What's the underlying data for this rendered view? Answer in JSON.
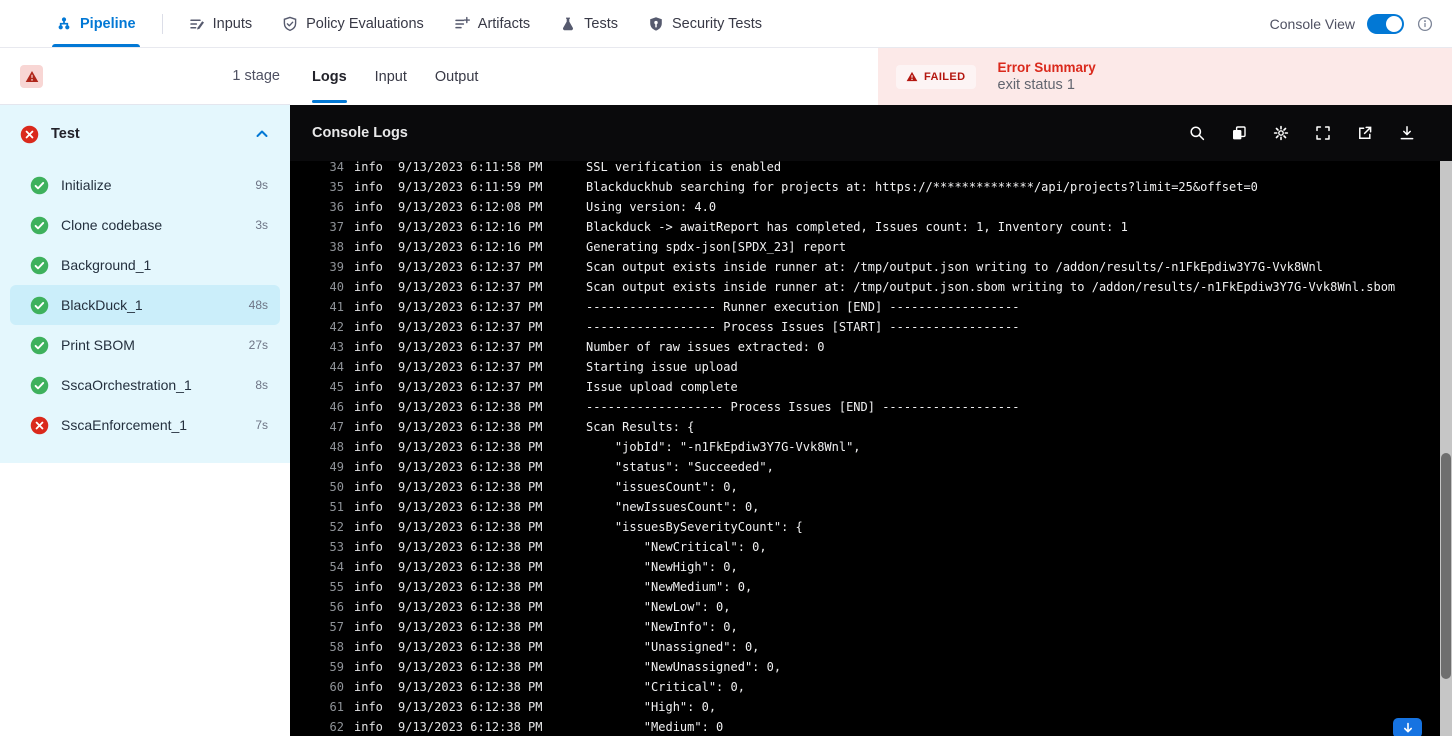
{
  "topnav": {
    "tabs": [
      {
        "label": "Pipeline",
        "icon": "pipeline-icon",
        "active": true
      },
      {
        "label": "Inputs",
        "icon": "inputs-icon",
        "active": false
      },
      {
        "label": "Policy Evaluations",
        "icon": "policy-evaluations-icon",
        "active": false
      },
      {
        "label": "Artifacts",
        "icon": "artifacts-icon",
        "active": false
      },
      {
        "label": "Tests",
        "icon": "tests-icon",
        "active": false
      },
      {
        "label": "Security Tests",
        "icon": "security-tests-icon",
        "active": false
      }
    ],
    "console_view": {
      "label": "Console View",
      "enabled": true,
      "info_icon": "info-circle-icon"
    }
  },
  "sidebar": {
    "stage_count": "1 stage",
    "warning_icon": "warning-triangle-icon",
    "stage": {
      "name": "Test",
      "status": "failed",
      "status_icon": "error-circle-icon",
      "collapse_icon": "chevron-up-icon"
    },
    "steps": [
      {
        "label": "Initialize",
        "duration": "9s",
        "status": "success",
        "selected": false
      },
      {
        "label": "Clone codebase",
        "duration": "3s",
        "status": "success",
        "selected": false
      },
      {
        "label": "Background_1",
        "duration": "",
        "status": "success",
        "selected": false
      },
      {
        "label": "BlackDuck_1",
        "duration": "48s",
        "status": "success",
        "selected": true
      },
      {
        "label": "Print SBOM",
        "duration": "27s",
        "status": "success",
        "selected": false
      },
      {
        "label": "SscaOrchestration_1",
        "duration": "8s",
        "status": "success",
        "selected": false
      },
      {
        "label": "SscaEnforcement_1",
        "duration": "7s",
        "status": "failed",
        "selected": false
      }
    ]
  },
  "main": {
    "tabs": [
      {
        "label": "Logs",
        "active": true
      },
      {
        "label": "Input",
        "active": false
      },
      {
        "label": "Output",
        "active": false
      }
    ],
    "error_summary": {
      "badge": "FAILED",
      "title": "Error Summary",
      "message": "exit status 1"
    },
    "console": {
      "title": "Console Logs",
      "toolbar_icons": [
        "search-icon",
        "copy-icon",
        "settings-icon",
        "fullscreen-icon",
        "open-in-new-icon",
        "download-icon"
      ],
      "scroll_to_bottom_icon": "arrow-down-icon"
    },
    "logs": [
      {
        "n": "34",
        "level": "info",
        "time": "9/13/2023 6:11:58 PM",
        "msg": "SSL verification is enabled"
      },
      {
        "n": "35",
        "level": "info",
        "time": "9/13/2023 6:11:59 PM",
        "msg": "Blackduckhub searching for projects at: https://**************/api/projects?limit=25&offset=0"
      },
      {
        "n": "36",
        "level": "info",
        "time": "9/13/2023 6:12:08 PM",
        "msg": "Using version: 4.0"
      },
      {
        "n": "37",
        "level": "info",
        "time": "9/13/2023 6:12:16 PM",
        "msg": "Blackduck -> awaitReport has completed, Issues count: 1, Inventory count: 1"
      },
      {
        "n": "38",
        "level": "info",
        "time": "9/13/2023 6:12:16 PM",
        "msg": "Generating spdx-json[SPDX_23] report"
      },
      {
        "n": "39",
        "level": "info",
        "time": "9/13/2023 6:12:37 PM",
        "msg": "Scan output exists inside runner at: /tmp/output.json writing to /addon/results/-n1FkEpdiw3Y7G-Vvk8Wnl"
      },
      {
        "n": "40",
        "level": "info",
        "time": "9/13/2023 6:12:37 PM",
        "msg": "Scan output exists inside runner at: /tmp/output.json.sbom writing to /addon/results/-n1FkEpdiw3Y7G-Vvk8Wnl.sbom"
      },
      {
        "n": "41",
        "level": "info",
        "time": "9/13/2023 6:12:37 PM",
        "msg": "------------------ Runner execution [END] ------------------"
      },
      {
        "n": "42",
        "level": "info",
        "time": "9/13/2023 6:12:37 PM",
        "msg": "------------------ Process Issues [START] ------------------"
      },
      {
        "n": "43",
        "level": "info",
        "time": "9/13/2023 6:12:37 PM",
        "msg": "Number of raw issues extracted: 0"
      },
      {
        "n": "44",
        "level": "info",
        "time": "9/13/2023 6:12:37 PM",
        "msg": "Starting issue upload"
      },
      {
        "n": "45",
        "level": "info",
        "time": "9/13/2023 6:12:37 PM",
        "msg": "Issue upload complete"
      },
      {
        "n": "46",
        "level": "info",
        "time": "9/13/2023 6:12:38 PM",
        "msg": "------------------- Process Issues [END] -------------------"
      },
      {
        "n": "47",
        "level": "info",
        "time": "9/13/2023 6:12:38 PM",
        "msg": "Scan Results: {"
      },
      {
        "n": "48",
        "level": "info",
        "time": "9/13/2023 6:12:38 PM",
        "msg": "    \"jobId\": \"-n1FkEpdiw3Y7G-Vvk8Wnl\","
      },
      {
        "n": "49",
        "level": "info",
        "time": "9/13/2023 6:12:38 PM",
        "msg": "    \"status\": \"Succeeded\","
      },
      {
        "n": "50",
        "level": "info",
        "time": "9/13/2023 6:12:38 PM",
        "msg": "    \"issuesCount\": 0,"
      },
      {
        "n": "51",
        "level": "info",
        "time": "9/13/2023 6:12:38 PM",
        "msg": "    \"newIssuesCount\": 0,"
      },
      {
        "n": "52",
        "level": "info",
        "time": "9/13/2023 6:12:38 PM",
        "msg": "    \"issuesBySeverityCount\": {"
      },
      {
        "n": "53",
        "level": "info",
        "time": "9/13/2023 6:12:38 PM",
        "msg": "        \"NewCritical\": 0,"
      },
      {
        "n": "54",
        "level": "info",
        "time": "9/13/2023 6:12:38 PM",
        "msg": "        \"NewHigh\": 0,"
      },
      {
        "n": "55",
        "level": "info",
        "time": "9/13/2023 6:12:38 PM",
        "msg": "        \"NewMedium\": 0,"
      },
      {
        "n": "56",
        "level": "info",
        "time": "9/13/2023 6:12:38 PM",
        "msg": "        \"NewLow\": 0,"
      },
      {
        "n": "57",
        "level": "info",
        "time": "9/13/2023 6:12:38 PM",
        "msg": "        \"NewInfo\": 0,"
      },
      {
        "n": "58",
        "level": "info",
        "time": "9/13/2023 6:12:38 PM",
        "msg": "        \"Unassigned\": 0,"
      },
      {
        "n": "59",
        "level": "info",
        "time": "9/13/2023 6:12:38 PM",
        "msg": "        \"NewUnassigned\": 0,"
      },
      {
        "n": "60",
        "level": "info",
        "time": "9/13/2023 6:12:38 PM",
        "msg": "        \"Critical\": 0,"
      },
      {
        "n": "61",
        "level": "info",
        "time": "9/13/2023 6:12:38 PM",
        "msg": "        \"High\": 0,"
      },
      {
        "n": "62",
        "level": "info",
        "time": "9/13/2023 6:12:38 PM",
        "msg": "        \"Medium\": 0"
      }
    ]
  },
  "colors": {
    "accent": "#0278d5",
    "error": "#da291c",
    "error_bg": "#fce9e8",
    "success": "#3eb15d",
    "sidebar_bg": "#e4f7fd",
    "selected_step_bg": "#cbeefa",
    "console_bg": "#000000"
  }
}
